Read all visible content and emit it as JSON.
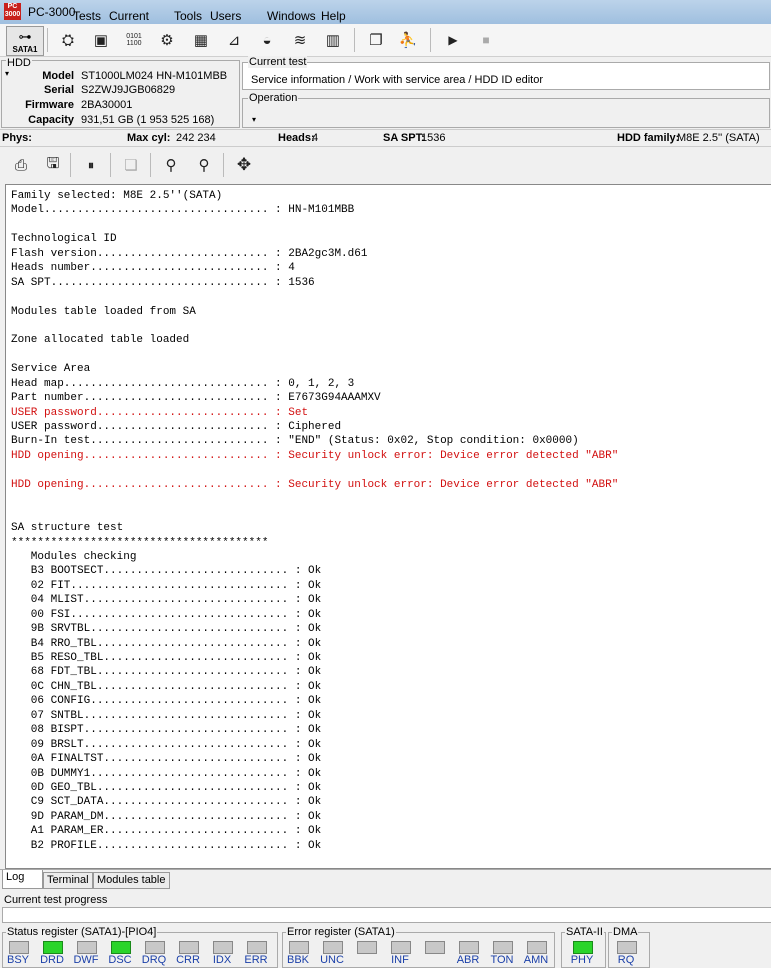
{
  "app": {
    "title": "PC-3000",
    "icon_text": "PC 3000"
  },
  "menu": [
    "Tests",
    "Current test",
    "Tools",
    "Users tests",
    "Windows",
    "Help"
  ],
  "toolbar": {
    "sata_label": "SATA1",
    "icons": [
      "hdd-id-icon",
      "drive-icon",
      "sector-editor-icon",
      "utility-icon",
      "chip-icon",
      "chart-icon",
      "disk-icon",
      "head-icon",
      "table-icon",
      "copy-window-icon",
      "user-run-icon",
      "play-icon",
      "stop-icon"
    ]
  },
  "hdd": {
    "legend": "HDD",
    "model_label": "Model",
    "model": "ST1000LM024 HN-M101MBB",
    "serial_label": "Serial",
    "serial": "S2ZWJ9JGB06829",
    "firmware_label": "Firmware",
    "firmware": "2BA30001",
    "capacity_label": "Capacity",
    "capacity": "931,51 GB (1 953 525 168)"
  },
  "current_test": {
    "legend": "Current test",
    "value": "Service information / Work with service area / HDD ID editor"
  },
  "operation": {
    "legend": "Operation",
    "value": ""
  },
  "phys": {
    "phys_label": "Phys:",
    "maxcyl_label": "Max cyl:",
    "maxcyl": "242 234",
    "heads_label": "Heads:",
    "heads": "4",
    "saspt_label": "SA SPT:",
    "saspt": "1536",
    "family_label": "HDD family:",
    "family": "M8E 2.5'' (SATA)"
  },
  "log": {
    "lines": [
      {
        "t": "Family selected: M8E 2.5''(SATA)",
        "c": "normal"
      },
      {
        "t": "Model.................................. : HN-M101MBB",
        "c": "normal"
      },
      {
        "t": "",
        "c": "normal"
      },
      {
        "t": "Technological ID",
        "c": "normal"
      },
      {
        "t": "Flash version.......................... : 2BA2gc3M.d61",
        "c": "normal"
      },
      {
        "t": "Heads number........................... : 4",
        "c": "normal"
      },
      {
        "t": "SA SPT................................. : 1536",
        "c": "normal"
      },
      {
        "t": "",
        "c": "normal"
      },
      {
        "t": "Modules table loaded from SA",
        "c": "normal"
      },
      {
        "t": "",
        "c": "normal"
      },
      {
        "t": "Zone allocated table loaded",
        "c": "normal"
      },
      {
        "t": "",
        "c": "normal"
      },
      {
        "t": "Service Area",
        "c": "normal"
      },
      {
        "t": "Head map............................... : 0, 1, 2, 3",
        "c": "normal"
      },
      {
        "t": "Part number............................ : E7673G94AAAMXV",
        "c": "normal"
      },
      {
        "t": "USER password.......................... : Set",
        "c": "red"
      },
      {
        "t": "USER password.......................... : Ciphered",
        "c": "normal"
      },
      {
        "t": "Burn-In test........................... : \"END\" (Status: 0x02, Stop condition: 0x0000)",
        "c": "normal"
      },
      {
        "t": "HDD opening............................ : Security unlock error: Device error detected \"ABR\"",
        "c": "red"
      },
      {
        "t": "",
        "c": "normal"
      },
      {
        "t": "HDD opening............................ : Security unlock error: Device error detected \"ABR\"",
        "c": "red"
      },
      {
        "t": "",
        "c": "normal"
      },
      {
        "t": "",
        "c": "normal"
      },
      {
        "t": "SA structure test",
        "c": "normal"
      },
      {
        "t": "***************************************",
        "c": "normal"
      },
      {
        "t": "   Modules checking",
        "c": "normal"
      },
      {
        "t": "   B3 BOOTSECT............................ : Ok",
        "c": "normal"
      },
      {
        "t": "   02 FIT................................. : Ok",
        "c": "normal"
      },
      {
        "t": "   04 MLIST............................... : Ok",
        "c": "normal"
      },
      {
        "t": "   00 FSI................................. : Ok",
        "c": "normal"
      },
      {
        "t": "   9B SRVTBL.............................. : Ok",
        "c": "normal"
      },
      {
        "t": "   B4 RRO_TBL............................. : Ok",
        "c": "normal"
      },
      {
        "t": "   B5 RESO_TBL............................ : Ok",
        "c": "normal"
      },
      {
        "t": "   68 FDT_TBL............................. : Ok",
        "c": "normal"
      },
      {
        "t": "   0C CHN_TBL............................. : Ok",
        "c": "normal"
      },
      {
        "t": "   06 CONFIG.............................. : Ok",
        "c": "normal"
      },
      {
        "t": "   07 SNTBL............................... : Ok",
        "c": "normal"
      },
      {
        "t": "   08 BISPT............................... : Ok",
        "c": "normal"
      },
      {
        "t": "   09 BRSLT............................... : Ok",
        "c": "normal"
      },
      {
        "t": "   0A FINALTST............................ : Ok",
        "c": "normal"
      },
      {
        "t": "   0B DUMMY1.............................. : Ok",
        "c": "normal"
      },
      {
        "t": "   0D GEO_TBL............................. : Ok",
        "c": "normal"
      },
      {
        "t": "   C9 SCT_DATA............................ : Ok",
        "c": "normal"
      },
      {
        "t": "   9D PARAM_DM............................ : Ok",
        "c": "normal"
      },
      {
        "t": "   A1 PARAM_ER............................ : Ok",
        "c": "normal"
      },
      {
        "t": "   B2 PROFILE............................. : Ok",
        "c": "normal"
      }
    ]
  },
  "tabs": [
    "Log",
    "Terminal",
    "Modules table"
  ],
  "progress": {
    "label": "Current test progress",
    "percent": 0
  },
  "status_register": {
    "legend": "Status register (SATA1)-[PIO4]",
    "leds": [
      {
        "name": "BSY",
        "on": false
      },
      {
        "name": "DRD",
        "on": true
      },
      {
        "name": "DWF",
        "on": false
      },
      {
        "name": "DSC",
        "on": true
      },
      {
        "name": "DRQ",
        "on": false
      },
      {
        "name": "CRR",
        "on": false
      },
      {
        "name": "IDX",
        "on": false
      },
      {
        "name": "ERR",
        "on": false
      }
    ]
  },
  "error_register": {
    "legend": "Error register (SATA1)",
    "leds": [
      {
        "name": "BBK",
        "on": false
      },
      {
        "name": "UNC",
        "on": false
      },
      {
        "name": "",
        "on": false
      },
      {
        "name": "INF",
        "on": false
      },
      {
        "name": "",
        "on": false
      },
      {
        "name": "ABR",
        "on": false
      },
      {
        "name": "TON",
        "on": false
      },
      {
        "name": "AMN",
        "on": false
      }
    ]
  },
  "sata2": {
    "legend": "SATA-II",
    "leds": [
      {
        "name": "PHY",
        "on": true
      }
    ]
  },
  "dma": {
    "legend": "DMA",
    "leds": [
      {
        "name": "RQ",
        "on": false
      }
    ]
  }
}
